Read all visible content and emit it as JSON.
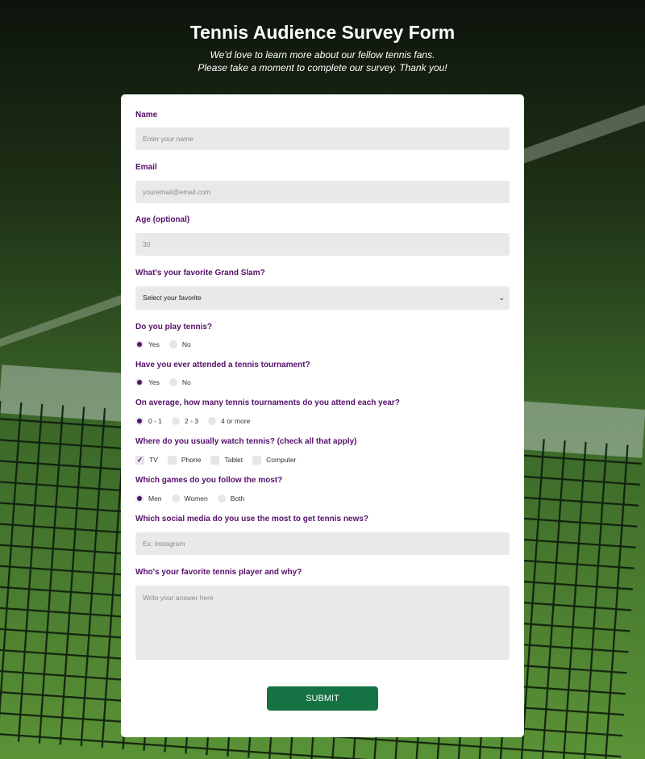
{
  "header": {
    "title": "Tennis Audience Survey Form",
    "subtitle_line1": "We'd love to learn more about our fellow tennis fans.",
    "subtitle_line2": "Please take a moment to complete our survey. Thank you!"
  },
  "form": {
    "name": {
      "label": "Name",
      "placeholder": "Enter your name"
    },
    "email": {
      "label": "Email",
      "placeholder": "youremail@email.com"
    },
    "age": {
      "label": "Age (optional)",
      "placeholder": "30"
    },
    "grand_slam": {
      "label": "What's your favorite Grand Slam?",
      "selected": "Select your favorite"
    },
    "play_tennis": {
      "label": "Do you play tennis?",
      "options": [
        "Yes",
        "No"
      ],
      "selected": "Yes"
    },
    "attended": {
      "label": "Have you ever attended a tennis tournament?",
      "options": [
        "Yes",
        "No"
      ],
      "selected": "Yes"
    },
    "tournaments_per_year": {
      "label": "On average, how many tennis tournaments do you attend each year?",
      "options": [
        "0 - 1",
        "2 - 3",
        "4 or more"
      ],
      "selected": "0 - 1"
    },
    "watch": {
      "label": "Where do you usually watch tennis? (check all that apply)",
      "options": [
        "TV",
        "Phone",
        "Tablet",
        "Computer"
      ],
      "checked": [
        "TV"
      ]
    },
    "games": {
      "label": "Which games do you follow the most?",
      "options": [
        "Men",
        "Women",
        "Both"
      ],
      "selected": "Men"
    },
    "social_media": {
      "label": "Which social media do you use the most to get tennis news?",
      "placeholder": "Ex: Instagram"
    },
    "favorite_player": {
      "label": "Who's your favorite tennis player and why?",
      "placeholder": "Write your answer here"
    },
    "submit_label": "SUBMIT"
  },
  "colors": {
    "accent": "#55106b",
    "button": "#157243",
    "field_bg": "#e9e9e9"
  }
}
